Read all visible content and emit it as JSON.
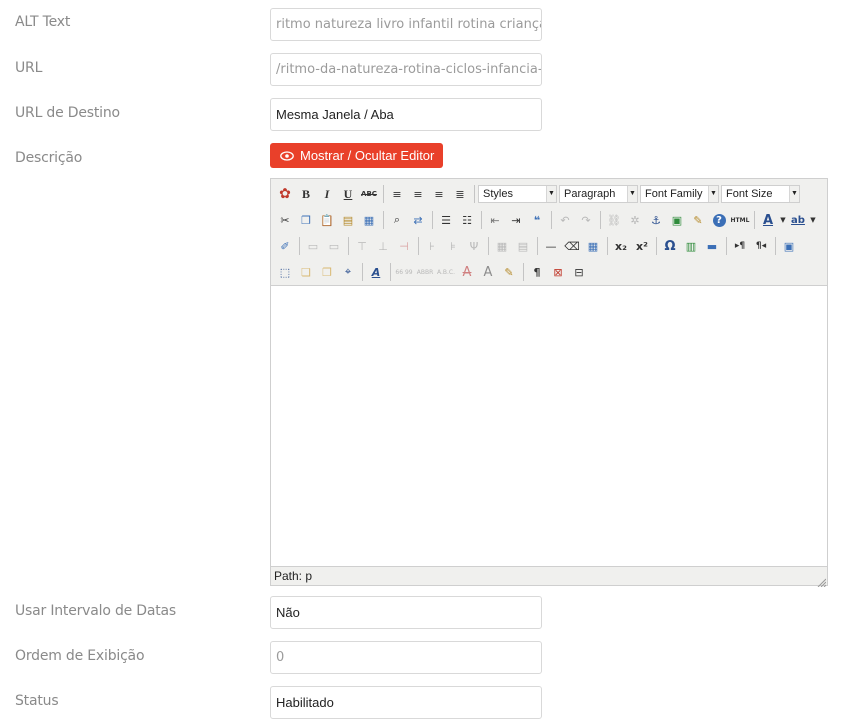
{
  "fields": {
    "alt_text": {
      "label": "ALT Text",
      "value": "ritmo natureza livro infantil rotina criança"
    },
    "url": {
      "label": "URL",
      "value": "/ritmo-da-natureza-rotina-ciclos-infancia-livro"
    },
    "url_destino": {
      "label": "URL de Destino",
      "value": "Mesma Janela / Aba"
    },
    "descricao": {
      "label": "Descrição"
    },
    "usar_intervalo": {
      "label": "Usar Intervalo de Datas",
      "value": "Não"
    },
    "ordem": {
      "label": "Ordem de Exibição",
      "value": "0"
    },
    "status": {
      "label": "Status",
      "value": "Habilitado"
    }
  },
  "toggle_editor": {
    "label": "Mostrar / Ocultar Editor",
    "icon": "eye-icon"
  },
  "editor": {
    "selects": {
      "styles": "Styles",
      "paragraph": "Paragraph",
      "font_family": "Font Family",
      "font_size": "Font Size"
    },
    "buttons": {
      "bold": "B",
      "italic": "I",
      "underline": "U",
      "strike": "ABC",
      "subscript": "x₂",
      "superscript": "x²",
      "omega": "Ω",
      "paragraph_mark": "¶",
      "html": "HTML",
      "abbr": "ABBR",
      "acronym": "A.B.C.",
      "cite": "66 99"
    },
    "path_label": "Path: p"
  },
  "colors": {
    "accent": "#e9402a",
    "label": "#8a8a8a",
    "border": "#d9d9d9"
  }
}
